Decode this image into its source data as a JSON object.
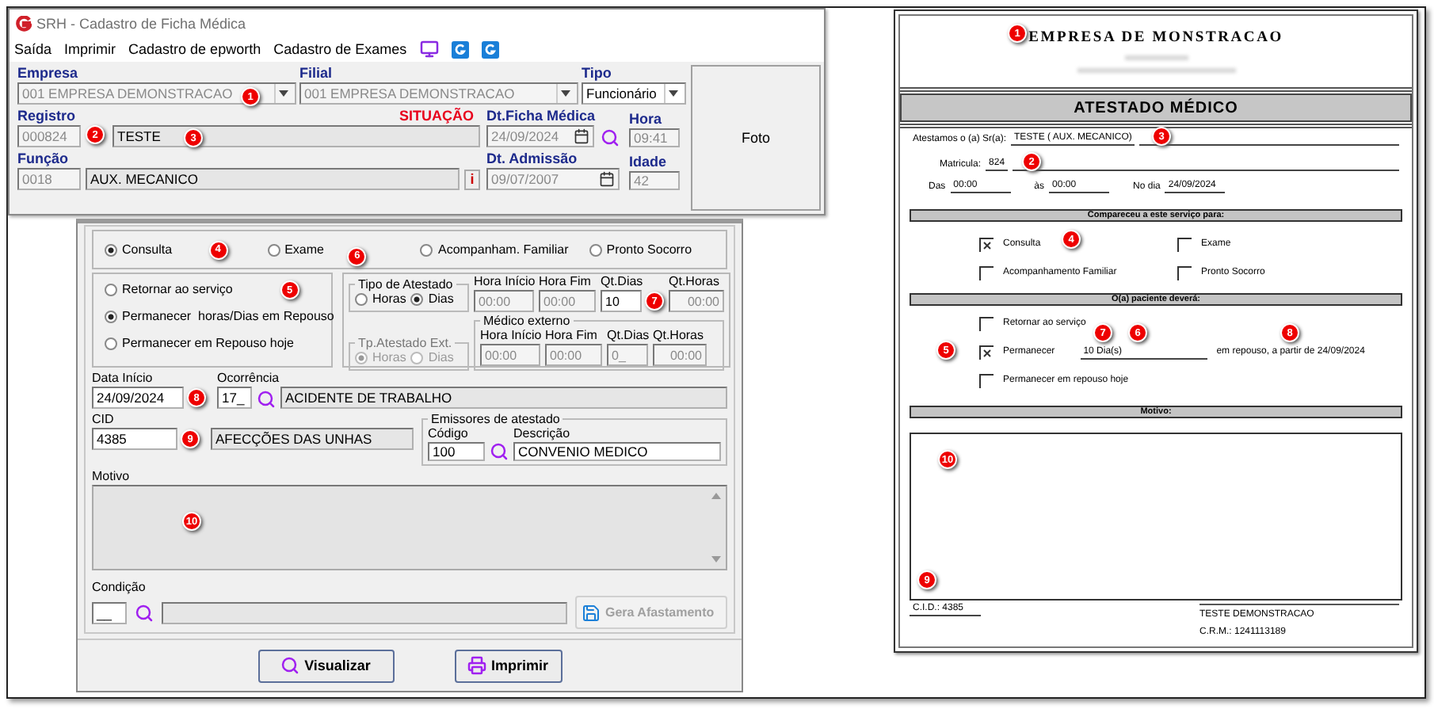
{
  "top_window": {
    "title": "SRH - Cadastro de Ficha Médica",
    "menu": [
      {
        "label": "Saída"
      },
      {
        "label": "Imprimir"
      },
      {
        "label": "Cadastro de epworth"
      },
      {
        "label": "Cadastro de Exames"
      }
    ],
    "empresa": {
      "label": "Empresa",
      "value": "001 EMPRESA DEMONSTRACAO",
      "disabled": true
    },
    "filial": {
      "label": "Filial",
      "value": "001 EMPRESA DEMONSTRACAO",
      "disabled": true
    },
    "tipo": {
      "label": "Tipo",
      "value": "Funcionário",
      "disabled": false
    },
    "registro": {
      "label": "Registro",
      "value": "000824",
      "disabled": true
    },
    "nome": {
      "value": "TESTE",
      "disabled": false
    },
    "situacao": "SITUAÇÃO",
    "dt_ficha": {
      "label": "Dt.Ficha Médica",
      "value": "24/09/2024",
      "disabled": true
    },
    "hora": {
      "label": "Hora",
      "value": "09:41",
      "disabled": true
    },
    "funcao": {
      "label": "Função",
      "code": {
        "value": "0018",
        "disabled": true
      },
      "description": {
        "value": "AUX. MECANICO",
        "disabled": false
      }
    },
    "info_button": "i",
    "dt_admissao": {
      "label": "Dt. Admissão",
      "value": "09/07/2007",
      "disabled": true
    },
    "idade": {
      "label": "Idade",
      "value": "42",
      "disabled": true
    },
    "photo": "Foto",
    "badges": [
      "1",
      "2",
      "3"
    ]
  },
  "form": {
    "visit_type": [
      {
        "label": "Consulta",
        "selected": true
      },
      {
        "label": "Exame",
        "selected": false
      },
      {
        "label": "Acompanham. Familiar",
        "selected": false
      },
      {
        "label": "Pronto Socorro",
        "selected": false
      }
    ],
    "instruction": [
      {
        "label": "Retornar ao serviço",
        "selected": false
      },
      {
        "label": "Permanecer  horas/Dias em Repouso",
        "selected": true
      },
      {
        "label": "Permanecer em Repouso hoje",
        "selected": false
      }
    ],
    "tipo_atestado": {
      "title": "Tipo de Atestado",
      "options": [
        {
          "label": "Horas",
          "selected": false
        },
        {
          "label": "Dias",
          "selected": true
        }
      ],
      "fields": [
        {
          "label": "Hora Início",
          "value": "00:00",
          "disabled": true
        },
        {
          "label": "Hora Fim",
          "value": "00:00",
          "disabled": true
        },
        {
          "label": "Qt.Dias",
          "value": "10",
          "disabled": false
        },
        {
          "label": "Qt.Horas",
          "value": "00:00",
          "disabled": true
        }
      ]
    },
    "tp_atestado_ext": {
      "title": "Tp.Atestado Ext.",
      "disabled": true,
      "options": [
        {
          "label": "Horas",
          "selected": true
        },
        {
          "label": "Dias",
          "selected": false
        }
      ]
    },
    "medico_externo": {
      "title": "Médico externo",
      "fields": [
        {
          "label": "Hora Início",
          "value": "00:00",
          "disabled": true
        },
        {
          "label": "Hora Fim",
          "value": "00:00",
          "disabled": true
        },
        {
          "label": "Qt.Dias",
          "value": "0_",
          "disabled": true
        },
        {
          "label": "Qt.Horas",
          "value": "00:00",
          "disabled": true
        }
      ]
    },
    "data_inicio": {
      "label": "Data Início",
      "value": "24/09/2024"
    },
    "ocorrencia": {
      "label": "Ocorrência",
      "code": "17_",
      "value": "ACIDENTE DE TRABALHO"
    },
    "cid": {
      "label": "CID",
      "value": "4385",
      "description": "AFECÇÕES DAS UNHAS"
    },
    "emissores": {
      "title": "Emissores de atestado",
      "codigo": {
        "label": "Código",
        "value": "100"
      },
      "descricao": {
        "label": "Descrição",
        "value": "CONVENIO MEDICO"
      }
    },
    "motivo": {
      "label": "Motivo"
    },
    "condicao": {
      "label": "Condição",
      "value": "__"
    },
    "gera_afastamento": {
      "label": "Gera Afastamento",
      "disabled": true
    },
    "buttons": [
      {
        "label": "Visualizar",
        "kind": "preview"
      },
      {
        "label": "Imprimir",
        "kind": "print"
      }
    ],
    "badges": [
      "4",
      "6",
      "5",
      "7",
      "8",
      "9",
      "10"
    ]
  },
  "document": {
    "company": "EMPRESA DE MONSTRACAO",
    "title": "ATESTADO MÉDICO",
    "patient": {
      "label": "Atestamos o (a) Sr(a):",
      "value": "TESTE ( AUX. MECANICO)"
    },
    "matricula": {
      "label": "Matricula:",
      "value": "824"
    },
    "times": [
      {
        "label": "Das",
        "value": "00:00"
      },
      {
        "label": "às",
        "value": "00:00"
      },
      {
        "label": "No dia",
        "value": "24/09/2024"
      }
    ],
    "service_section": "Compareceu a este serviço para:",
    "services": [
      {
        "label": "Consulta",
        "checked": true
      },
      {
        "label": "Exame",
        "checked": false
      },
      {
        "label": "Acompanhamento Familiar",
        "checked": false
      },
      {
        "label": "Pronto Socorro",
        "checked": false
      }
    ],
    "patient_section": "O(a) paciente deverá:",
    "actions": [
      {
        "label": "Retornar ao serviço",
        "checked": false
      },
      {
        "label": "Permanecer",
        "checked": true,
        "value": "10 Dia(s)",
        "suffix": "em repouso, a partir de 24/09/2024"
      },
      {
        "label": "Permanecer em repouso hoje",
        "checked": false
      }
    ],
    "motivo_section": "Motivo:",
    "cid": "C.I.D.: 4385",
    "signature": "TESTE DEMONSTRACAO",
    "crm": "C.R.M.: 1241113189",
    "badges": [
      "1",
      "3",
      "2",
      "4",
      "5",
      "7",
      "6",
      "8",
      "10",
      "9"
    ]
  }
}
